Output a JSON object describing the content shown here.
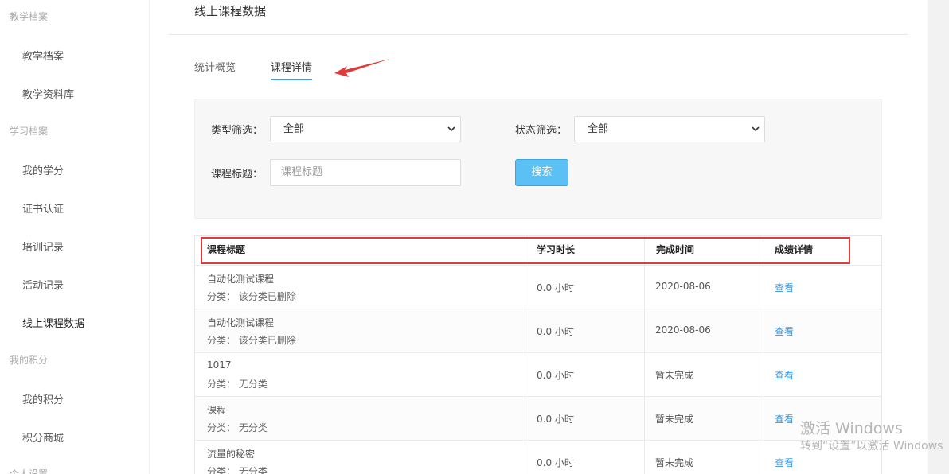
{
  "sidebar": {
    "groups": [
      {
        "label": "教学档案",
        "items": [
          "教学档案",
          "教学资料库"
        ]
      },
      {
        "label": "学习档案",
        "items": [
          "我的学分",
          "证书认证",
          "培训记录",
          "活动记录",
          "线上课程数据"
        ]
      },
      {
        "label": "我的积分",
        "items": [
          "我的积分",
          "积分商城"
        ]
      },
      {
        "label": "个人设置",
        "items": []
      }
    ],
    "active_item": "线上课程数据"
  },
  "main": {
    "title": "线上课程数据",
    "tabs": [
      {
        "label": "统计概览",
        "active": false
      },
      {
        "label": "课程详情",
        "active": true
      }
    ],
    "filters": {
      "type_label": "类型筛选：",
      "type_value": "全部",
      "status_label": "状态筛选：",
      "status_value": "全部",
      "title_label": "课程标题：",
      "title_placeholder": "课程标题",
      "search_button": "搜索"
    },
    "table": {
      "columns": [
        "课程标题",
        "学习时长",
        "完成时间",
        "成绩详情"
      ],
      "rows": [
        {
          "title": "自动化测试课程",
          "category": "分类：  该分类已删除",
          "duration": "0.0 小时",
          "completed": "2020-08-06",
          "action": "查看"
        },
        {
          "title": "自动化测试课程",
          "category": "分类：  该分类已删除",
          "duration": "0.0 小时",
          "completed": "2020-08-06",
          "action": "查看"
        },
        {
          "title": "1017",
          "category": "分类：  无分类",
          "duration": "0.0 小时",
          "completed": "暂未完成",
          "action": "查看"
        },
        {
          "title": "课程",
          "category": "分类：  无分类",
          "duration": "0.0 小时",
          "completed": "暂未完成",
          "action": "查看"
        },
        {
          "title": "流量的秘密",
          "category": "分类：  无分类",
          "duration": "0.0 小时",
          "completed": "暂未完成",
          "action": "查看"
        }
      ]
    }
  },
  "watermark": {
    "line1": "激活 Windows",
    "line2": "转到“设置”以激活 Windows"
  },
  "colors": {
    "accent": "#3aa0e6",
    "button": "#5bc0f3",
    "link": "#3a94d8",
    "annotation_red": "#e23a3a"
  }
}
